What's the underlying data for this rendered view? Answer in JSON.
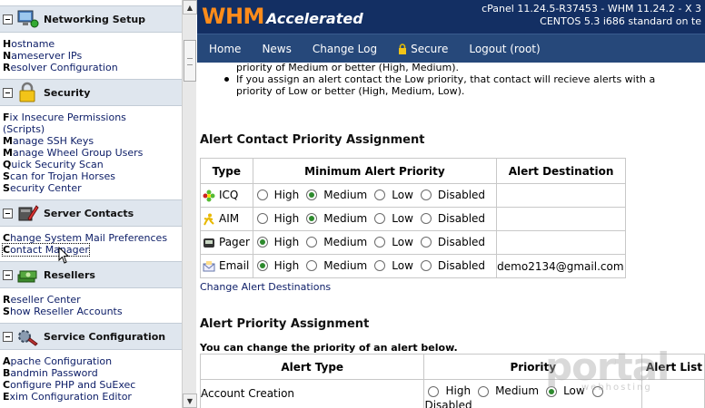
{
  "sidebar": {
    "sections": [
      {
        "title": "Networking Setup",
        "links": [
          {
            "key": "H",
            "rest": "ostname"
          },
          {
            "key": "N",
            "rest": "ameserver IPs"
          },
          {
            "key": "R",
            "rest": "esolver Configuration"
          }
        ]
      },
      {
        "title": "Security",
        "links": [
          {
            "key": "F",
            "rest": "ix Insecure Permissions"
          },
          {
            "key": "",
            "rest": "(Scripts)"
          },
          {
            "key": "M",
            "rest": "anage SSH Keys"
          },
          {
            "key": "M",
            "rest": "anage Wheel Group Users"
          },
          {
            "key": "Q",
            "rest": "uick Security Scan"
          },
          {
            "key": "S",
            "rest": "can for Trojan Horses"
          },
          {
            "key": "S",
            "rest": "ecurity Center"
          }
        ]
      },
      {
        "title": "Server Contacts",
        "links": [
          {
            "key": "C",
            "rest": "hange System Mail Preferences"
          },
          {
            "key": "C",
            "rest": "ontact Manager"
          }
        ]
      },
      {
        "title": "Resellers",
        "links": [
          {
            "key": "R",
            "rest": "eseller Center"
          },
          {
            "key": "S",
            "rest": "how Reseller Accounts"
          }
        ]
      },
      {
        "title": "Service Configuration",
        "links": [
          {
            "key": "A",
            "rest": "pache Configuration"
          },
          {
            "key": "B",
            "rest": "andmin Password"
          },
          {
            "key": "C",
            "rest": "onfigure PHP and SuExec"
          },
          {
            "key": "E",
            "rest": "xim Configuration Editor"
          }
        ]
      }
    ]
  },
  "header": {
    "logo_main": "WHM",
    "logo_sub": "Accelerated",
    "version_line1": "cPanel 11.24.5-R37453 - WHM 11.24.2 - X 3",
    "version_line2": "CENTOS 5.3 i686 standard on te"
  },
  "nav": [
    "Home",
    "News",
    "Change Log",
    "Secure",
    "Logout (root)"
  ],
  "content": {
    "bullet_cont": "priority of Medium or better (High, Medium).",
    "bullet2_l1": "If you assign an alert contact the Low priority, that contact will recieve alerts with a",
    "bullet2_l2": "priority of Low or better (High, Medium, Low).",
    "section1_title": "Alert Contact Priority Assignment",
    "table1_headers": [
      "Type",
      "Minimum Alert Priority",
      "Alert Destination"
    ],
    "option_labels": [
      "High",
      "Medium",
      "Low",
      "Disabled"
    ],
    "contacts": [
      {
        "type": "ICQ",
        "icon": "icq-flower-icon",
        "selected": 1,
        "destination": ""
      },
      {
        "type": "AIM",
        "icon": "aim-runner-icon",
        "selected": 1,
        "destination": ""
      },
      {
        "type": "Pager",
        "icon": "pager-icon",
        "selected": 0,
        "destination": ""
      },
      {
        "type": "Email",
        "icon": "email-envelope-icon",
        "selected": 0,
        "destination": "demo2134@gmail.com"
      }
    ],
    "change_link": "Change Alert Destinations",
    "section2_title": "Alert Priority Assignment",
    "section2_sub": "You can change the priority of an alert below.",
    "table2_headers": [
      "Alert Type",
      "Priority",
      "Alert List"
    ],
    "alert_rows": [
      {
        "type": "Account Creation",
        "selected": 2,
        "wrap_text": "Disabled"
      }
    ]
  },
  "watermark": {
    "main": "portal",
    "sub": "webhosting"
  }
}
